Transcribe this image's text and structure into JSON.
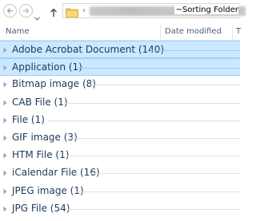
{
  "toolbar": {
    "back_icon": "back-arrow-icon",
    "forward_icon": "forward-arrow-icon",
    "recent_icon": "chevron-down-icon",
    "up_icon": "up-arrow-icon"
  },
  "address": {
    "folder_icon": "folder-icon",
    "separator": "›",
    "current_folder": "~Sorting Folder"
  },
  "columns": {
    "name": "Name",
    "date_modified": "Date modified",
    "type_initial": "T"
  },
  "groups": [
    {
      "label": "Adobe Acrobat Document (140)",
      "selected": true
    },
    {
      "label": "Application (1)",
      "selected": true
    },
    {
      "label": "Bitmap image (8)",
      "selected": false
    },
    {
      "label": "CAB File (1)",
      "selected": false
    },
    {
      "label": "File (1)",
      "selected": false
    },
    {
      "label": "GIF image (3)",
      "selected": false
    },
    {
      "label": "HTM File (1)",
      "selected": false
    },
    {
      "label": "iCalendar File (16)",
      "selected": false
    },
    {
      "label": "JPEG image (1)",
      "selected": false
    },
    {
      "label": "JPG File (54)",
      "selected": false
    }
  ],
  "colors": {
    "selection_fill": "#cce8ff",
    "selection_border": "#99d1ff",
    "group_text": "#1e395b"
  }
}
